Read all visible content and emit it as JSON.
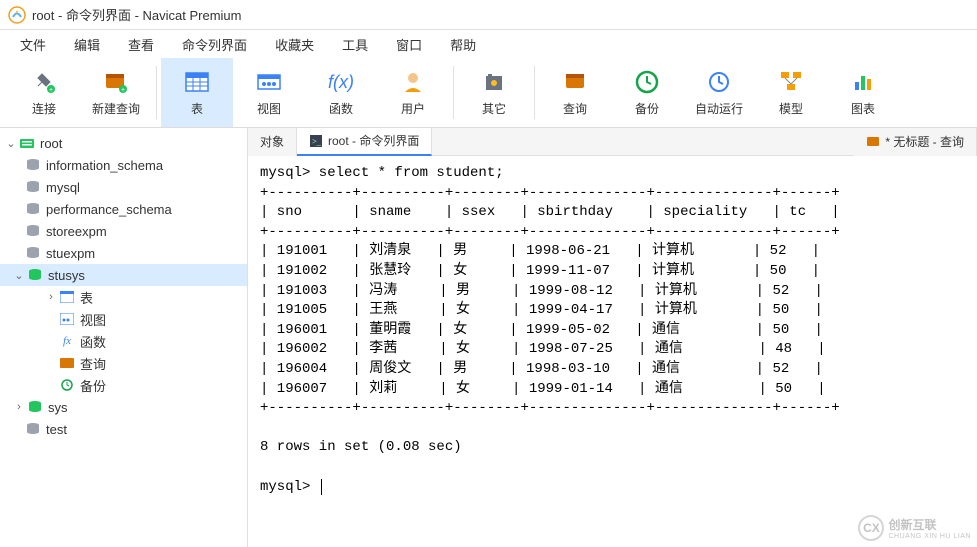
{
  "window": {
    "title": "root - 命令列界面 - Navicat Premium"
  },
  "menubar": [
    "文件",
    "编辑",
    "查看",
    "命令列界面",
    "收藏夹",
    "工具",
    "窗口",
    "帮助"
  ],
  "toolbar": [
    {
      "key": "connect",
      "label": "连接"
    },
    {
      "key": "newquery",
      "label": "新建查询"
    },
    {
      "key": "table",
      "label": "表",
      "active": true
    },
    {
      "key": "view",
      "label": "视图"
    },
    {
      "key": "function",
      "label": "函数"
    },
    {
      "key": "user",
      "label": "用户"
    },
    {
      "key": "other",
      "label": "其它"
    },
    {
      "key": "query",
      "label": "查询"
    },
    {
      "key": "backup",
      "label": "备份"
    },
    {
      "key": "autorun",
      "label": "自动运行"
    },
    {
      "key": "model",
      "label": "模型"
    },
    {
      "key": "chart",
      "label": "图表"
    }
  ],
  "tree": {
    "root": "root",
    "databases": [
      {
        "name": "information_schema",
        "active": false
      },
      {
        "name": "mysql",
        "active": false
      },
      {
        "name": "performance_schema",
        "active": false
      },
      {
        "name": "storeexpm",
        "active": false
      },
      {
        "name": "stuexpm",
        "active": false
      },
      {
        "name": "stusys",
        "active": true,
        "expanded": true,
        "children": [
          {
            "icon": "table",
            "label": "表"
          },
          {
            "icon": "view",
            "label": "视图"
          },
          {
            "icon": "fx",
            "label": "函数"
          },
          {
            "icon": "query",
            "label": "查询"
          },
          {
            "icon": "backup",
            "label": "备份"
          }
        ]
      },
      {
        "name": "sys",
        "active": true
      },
      {
        "name": "test",
        "active": false
      }
    ]
  },
  "tabs": {
    "left": [
      {
        "label": "对象",
        "active": false
      },
      {
        "label": "root - 命令列界面",
        "active": true,
        "icon": "cmd"
      }
    ],
    "right": [
      {
        "label": "* 无标题 - 查询",
        "icon": "query"
      }
    ]
  },
  "terminal": {
    "prompt1": "mysql> select * from student;",
    "header": [
      "sno",
      "sname",
      "ssex",
      "sbirthday",
      "speciality",
      "tc"
    ],
    "rows": [
      [
        "191001",
        "刘清泉",
        "男",
        "1998-06-21",
        "计算机",
        "52"
      ],
      [
        "191002",
        "张慧玲",
        "女",
        "1999-11-07",
        "计算机",
        "50"
      ],
      [
        "191003",
        "冯涛",
        "男",
        "1999-08-12",
        "计算机",
        "52"
      ],
      [
        "191005",
        "王燕",
        "女",
        "1999-04-17",
        "计算机",
        "50"
      ],
      [
        "196001",
        "董明霞",
        "女",
        "1999-05-02",
        "通信",
        "50"
      ],
      [
        "196002",
        "李茜",
        "女",
        "1998-07-25",
        "通信",
        "48"
      ],
      [
        "196004",
        "周俊文",
        "男",
        "1998-03-10",
        "通信",
        "52"
      ],
      [
        "196007",
        "刘莉",
        "女",
        "1999-01-14",
        "通信",
        "50"
      ]
    ],
    "footer": "8 rows in set (0.08 sec)",
    "prompt2": "mysql> "
  },
  "watermark": {
    "brand": "创新互联",
    "sub": "CHUANG XIN HU LIAN"
  }
}
